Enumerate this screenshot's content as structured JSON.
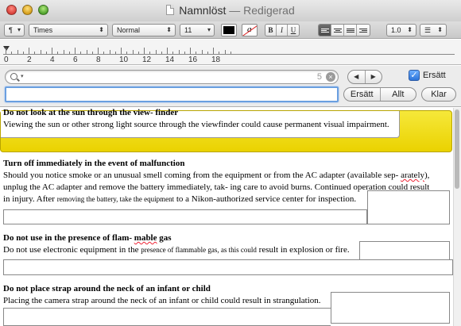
{
  "window": {
    "title": "Namnlöst",
    "separator": "—",
    "status": "Redigerad"
  },
  "format_bar": {
    "paragraph_style": "¶",
    "font_family": "Times",
    "font_style": "Normal",
    "font_size": "11",
    "text_color": "#000000",
    "bold": "B",
    "italic": "I",
    "underline": "U",
    "line_spacing": "1.0",
    "list_style": "☰"
  },
  "ruler": {
    "numbers": [
      "0",
      "2",
      "4",
      "6",
      "8",
      "10",
      "12",
      "14",
      "16",
      "18"
    ]
  },
  "find": {
    "search_value": "",
    "match_count": "5",
    "replace_checkbox_label": "Ersätt",
    "replace_checked": true,
    "replace_value": "",
    "replace_button": "Ersätt",
    "replace_all_button": "Allt",
    "done_button": "Klar"
  },
  "document": {
    "sections": [
      {
        "heading": "Do not look at the sun through the view- finder",
        "body": "Viewing the sun or other strong light source through the viewfinder could cause permanent visual impairment."
      },
      {
        "heading": "Turn off immediately in the event of malfunction",
        "line1": "Should you notice smoke or an unusual smell coming from the equipment or from the AC adapter (available sep- ",
        "line1_flag": "arately",
        "line1_end": "),",
        "line2": "unplug the AC adapter and remove the battery immediately, tak- ing care to avoid burns. Continued operation could result",
        "line3_a": "in injury. After ",
        "line3_small": "removing the battery, take the equipment",
        "line3_b": " to a Nikon-authorized service center for inspection."
      },
      {
        "heading_a": "Do not use in the presence of flam- ",
        "heading_flag": "mable",
        "heading_b": " gas",
        "body_a": "Do not use electronic equipment in the ",
        "body_small": "presence of flammable gas, as this could",
        "body_b": " result in explosion or fire."
      },
      {
        "heading": "Do not place strap around the neck of an infant or child",
        "body": "Placing the camera strap around the neck of an infant or child could result in strangulation."
      }
    ]
  },
  "colors": {
    "highlight": "#f0dc00",
    "selection_focus": "#6a9fe0",
    "checkbox": "#2c74d8"
  },
  "icons": {
    "search": "search-icon",
    "clear": "clear-icon",
    "previous": "chevron-left-icon",
    "next": "chevron-right-icon"
  }
}
